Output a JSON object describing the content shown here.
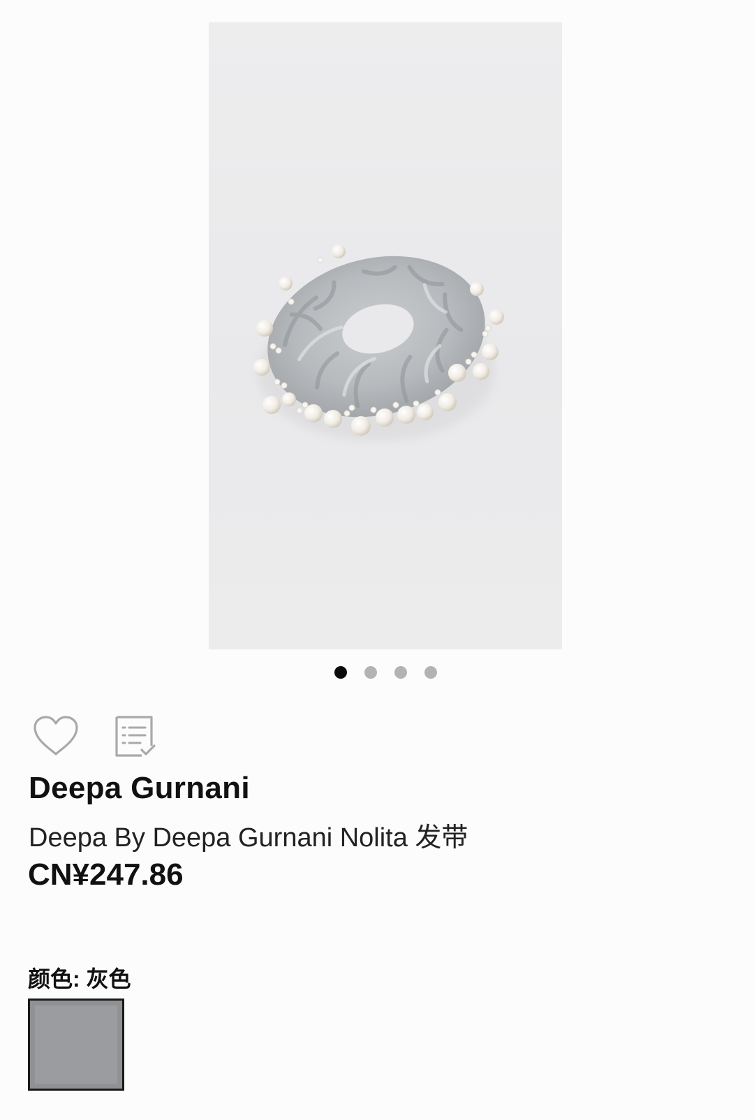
{
  "product": {
    "brand": "Deepa Gurnani",
    "name": "Deepa By Deepa Gurnani Nolita 发带",
    "price": "CN¥247.86",
    "image_alt": "Deepa By Deepa Gurnani Nolita 发带"
  },
  "carousel": {
    "dots": 4,
    "active_index": 0
  },
  "icons": {
    "wishlist": "heart-icon",
    "list": "checklist-icon"
  },
  "color": {
    "label": "颜色: 灰色",
    "swatch_hex": "#8f9193"
  },
  "theme": {
    "background": "#fdfcfc",
    "dot_active": "#0a0a0a",
    "dot_inactive": "#b3b3b3"
  }
}
